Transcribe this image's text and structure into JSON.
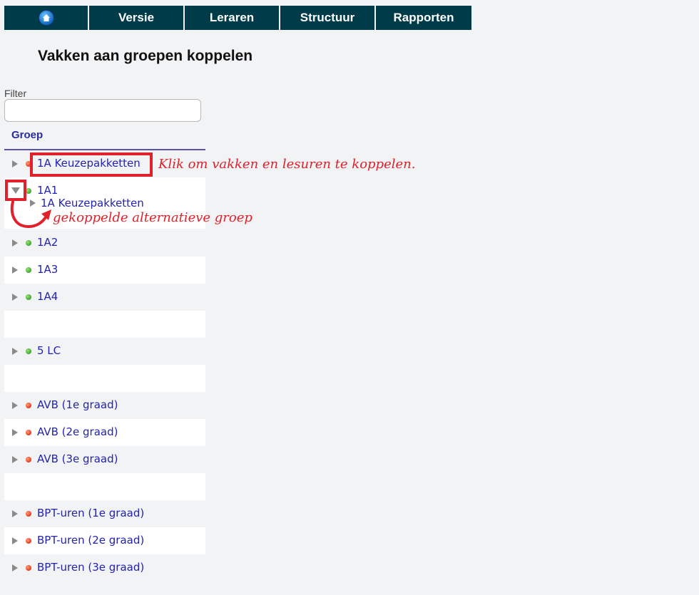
{
  "nav": {
    "home_icon": "home-icon",
    "items": [
      "Versie",
      "Leraren",
      "Structuur",
      "Rapporten"
    ]
  },
  "page_title": "Vakken aan groepen koppelen",
  "filter": {
    "label": "Filter",
    "value": "",
    "placeholder": ""
  },
  "table": {
    "column": "Groep"
  },
  "rows": [
    {
      "label": "1A Keuzepakketten",
      "status": "red",
      "expanded": false
    },
    {
      "label": "1A1",
      "status": "green",
      "expanded": true,
      "children": [
        "1A Keuzepakketten"
      ]
    },
    {
      "label": "1A2",
      "status": "green"
    },
    {
      "label": "1A3",
      "status": "green"
    },
    {
      "label": "1A4",
      "status": "green"
    },
    {
      "label": "",
      "status": "none"
    },
    {
      "label": "5 LC",
      "status": "green"
    },
    {
      "label": "",
      "status": "none"
    },
    {
      "label": "AVB (1e graad)",
      "status": "red"
    },
    {
      "label": "AVB (2e graad)",
      "status": "red"
    },
    {
      "label": "AVB (3e graad)",
      "status": "red"
    },
    {
      "label": "",
      "status": "none"
    },
    {
      "label": "BPT-uren (1e graad)",
      "status": "red"
    },
    {
      "label": "BPT-uren (2e graad)",
      "status": "red"
    },
    {
      "label": "BPT-uren (3e graad)",
      "status": "red"
    }
  ],
  "annotations": {
    "click_hint": "Klik om vakken en lesuren te koppelen.",
    "linked_hint": "gekoppelde alternatieve groep"
  },
  "colors": {
    "navbar": "#003b49",
    "annotation": "#e0202a",
    "link": "#2323b0"
  }
}
